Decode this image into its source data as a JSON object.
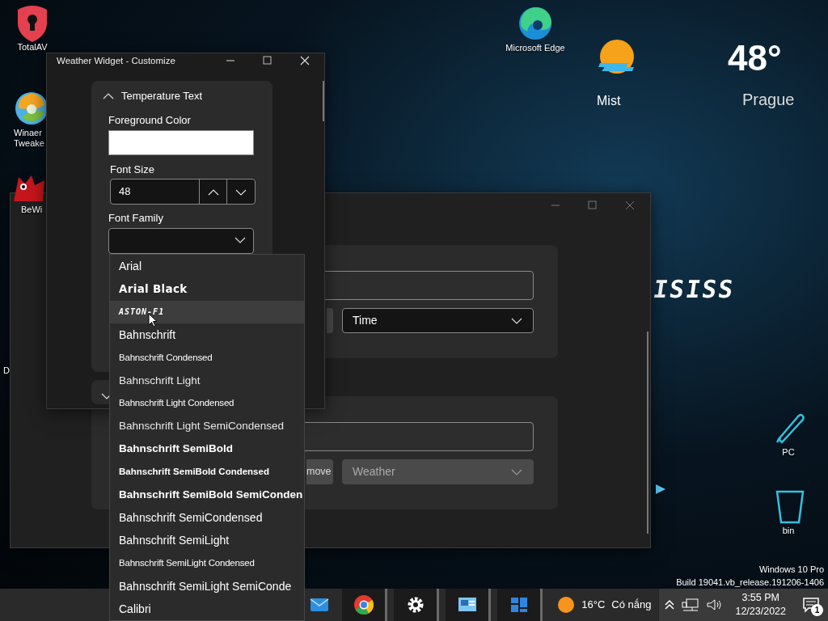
{
  "desktop_icons": [
    {
      "kind": "shield",
      "lines": [
        "TotalAV"
      ]
    },
    {
      "kind": "swirl",
      "lines": [
        "Winaer",
        "Tweake"
      ]
    },
    {
      "kind": "cat",
      "lines": [
        "BeWi"
      ]
    },
    {
      "kind": "edge",
      "lines": [
        "Microsoft Edge"
      ]
    },
    {
      "kind": "pen",
      "lines": [
        "PC"
      ]
    },
    {
      "kind": "bin",
      "lines": [
        "bin"
      ]
    },
    {
      "kind": "none",
      "lines": [
        "D"
      ]
    }
  ],
  "wallpaper_logo": "ISISS",
  "weather_widget": {
    "condition": "Mist",
    "temperature": "48°",
    "city": "Prague"
  },
  "back_window": {
    "cards": [
      {
        "select": "Time",
        "disabled": false
      },
      {
        "select": "Weather",
        "disabled": true,
        "button": "move"
      }
    ]
  },
  "customize_window": {
    "title": "Weather Widget - Customize",
    "section": {
      "title": "Temperature Text",
      "expanded": true,
      "foreground_label": "Foreground Color",
      "font_size_label": "Font Size",
      "font_size": "48",
      "font_family_label": "Font Family"
    }
  },
  "font_dropdown": [
    {
      "label": "Arial",
      "kind": "regular",
      "selected": false
    },
    {
      "label": "Arial Black",
      "kind": "black",
      "selected": false
    },
    {
      "label": "ASTON-F1",
      "kind": "display",
      "selected": true
    },
    {
      "label": "Bahnschrift",
      "kind": "medium",
      "selected": false
    },
    {
      "label": "Bahnschrift Condensed",
      "kind": "condensed",
      "selected": false
    },
    {
      "label": "Bahnschrift Light",
      "kind": "light",
      "selected": false
    },
    {
      "label": "Bahnschrift Light Condensed",
      "kind": "condensed",
      "selected": false
    },
    {
      "label": "Bahnschrift Light SemiCondensed",
      "kind": "light",
      "selected": false
    },
    {
      "label": "Bahnschrift SemiBold",
      "kind": "bold",
      "selected": false
    },
    {
      "label": "Bahnschrift SemiBold Condensed",
      "kind": "bold-condensed",
      "selected": false
    },
    {
      "label": "Bahnschrift SemiBold SemiConden",
      "kind": "bold",
      "selected": false
    },
    {
      "label": "Bahnschrift SemiCondensed",
      "kind": "medium",
      "selected": false
    },
    {
      "label": "Bahnschrift SemiLight",
      "kind": "regular",
      "selected": false
    },
    {
      "label": "Bahnschrift SemiLight Condensed",
      "kind": "condensed",
      "selected": false
    },
    {
      "label": "Bahnschrift SemiLight SemiConde",
      "kind": "regular",
      "selected": false
    },
    {
      "label": "Calibri",
      "kind": "regular",
      "selected": false
    }
  ],
  "os_watermark": [
    "Windows 10 Pro",
    "Build 19041.vb_release.191206-1406"
  ],
  "taskbar": {
    "apps": [
      {
        "kind": "mail",
        "open": false
      },
      {
        "kind": "chrome",
        "open": true
      },
      {
        "kind": "gear",
        "open": true
      },
      {
        "kind": "panel",
        "open": true
      },
      {
        "kind": "tiles",
        "open": true
      }
    ],
    "weather_temp": "16°C",
    "weather_text": "Có nắng",
    "time": "3:55 PM",
    "date": "12/23/2022",
    "notifications": "1"
  }
}
